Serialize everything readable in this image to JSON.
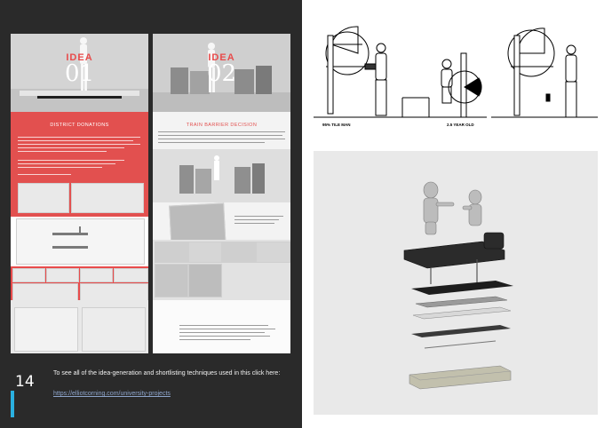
{
  "left_page": {
    "panel1": {
      "label": "IDEA",
      "number": "01",
      "section_title": "DISTRICT DONATIONS"
    },
    "panel2": {
      "label": "IDEA",
      "number": "02",
      "section_title": "TRAIN BARRIER DECISION"
    },
    "caption": "To see all of the idea-generation and shortlisting techniques used in this click here:",
    "link": "https://elliotcorning.com/university-projects",
    "page_number": "14"
  },
  "right_page": {
    "drawing": {
      "label_left": "95% TILE MAN",
      "label_right": "2.5 YEAR OLD"
    }
  },
  "colors": {
    "accent": "#e2504f",
    "dark_background": "#2a2a2a"
  }
}
